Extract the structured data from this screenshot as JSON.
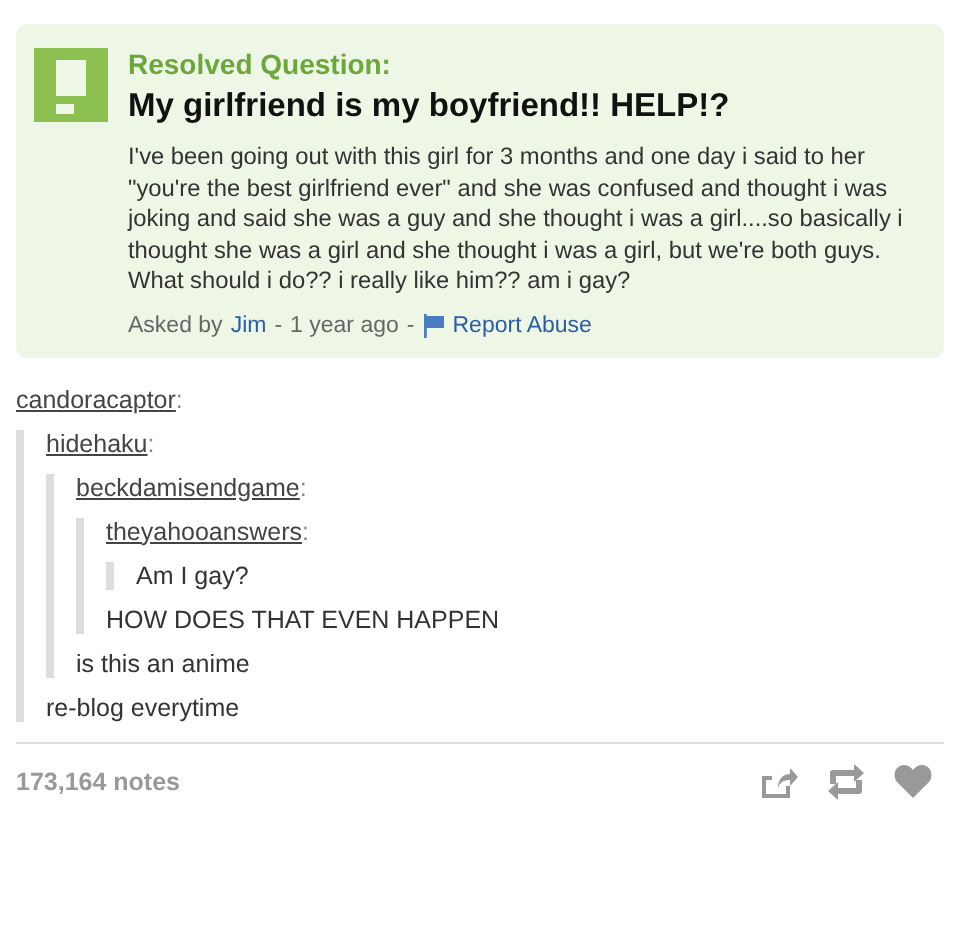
{
  "question": {
    "heading": "Resolved Question:",
    "title": "My girlfriend is my boyfriend!! HELP!?",
    "body": "I've been going out with this girl for 3 months and one day i said to her \"you're the best girlfriend ever\" and she was confused and thought i was joking and said she was a guy and she thought i was a girl....so basically i thought she was a girl and she thought i was a girl, but we're both guys. What should i do?? i really like him?? am i gay?",
    "asked_by": "Asked by",
    "author": "Jim",
    "separator_1": "-",
    "age": "1 year ago",
    "separator_2": "-",
    "report": "Report Abuse"
  },
  "thread": {
    "user": "candoracaptor",
    "colon": ":",
    "quote": {
      "user": "hidehaku",
      "colon": ":",
      "quote": {
        "user": "beckdamisendgame",
        "colon": ":",
        "quote": {
          "user": "theyahooanswers",
          "colon": ":",
          "quote": {
            "text": "Am I gay?"
          },
          "text": "HOW DOES THAT EVEN HAPPEN"
        },
        "text": "is this an anime"
      },
      "text": "re-blog everytime"
    }
  },
  "notes": "173,164 notes"
}
